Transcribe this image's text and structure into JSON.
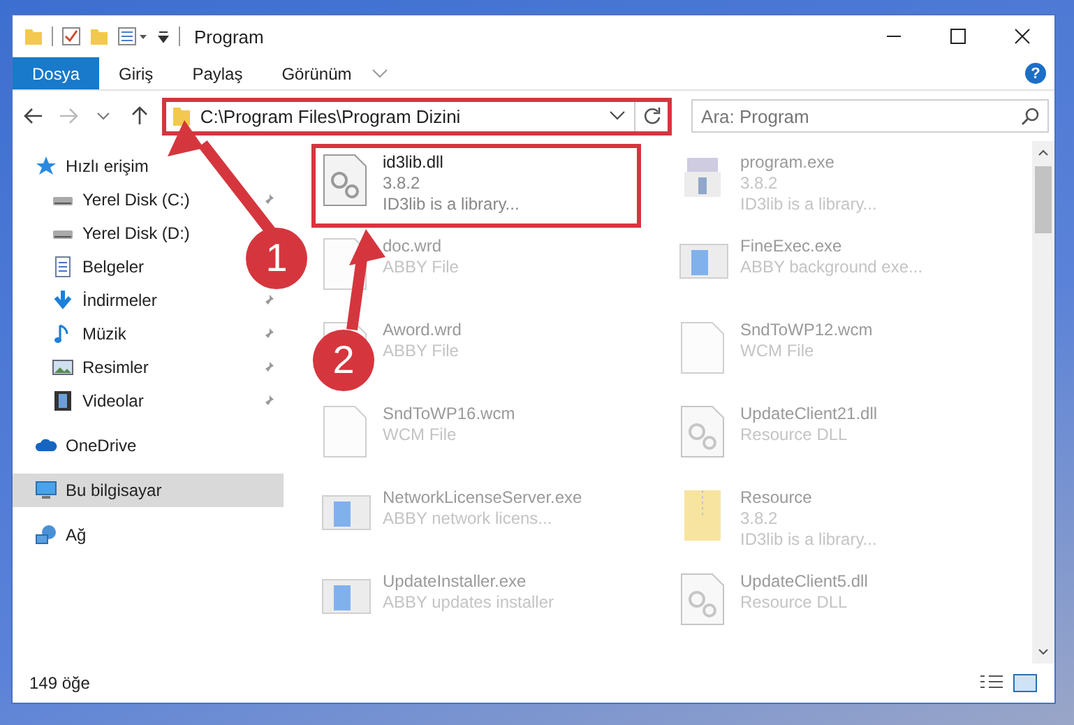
{
  "window": {
    "title": "Program"
  },
  "ribbon": {
    "tabs": [
      {
        "label": "Dosya",
        "selected": true
      },
      {
        "label": "Giriş",
        "selected": false
      },
      {
        "label": "Paylaş",
        "selected": false
      },
      {
        "label": "Görünüm",
        "selected": false
      }
    ],
    "help": "?"
  },
  "address_bar": {
    "path": "C:\\Program Files\\Program Dizini",
    "highlighted": true
  },
  "search": {
    "placeholder": "Ara: Program"
  },
  "sidebar": {
    "items": [
      {
        "label": "Hızlı erişim",
        "kind": "star",
        "pinned": false,
        "selected": false
      },
      {
        "label": "Yerel Disk (C:)",
        "kind": "disk",
        "pinned": true,
        "selected": false
      },
      {
        "label": "Yerel Disk (D:)",
        "kind": "disk",
        "pinned": false,
        "selected": false
      },
      {
        "label": "Belgeler",
        "kind": "docs",
        "pinned": false,
        "selected": false
      },
      {
        "label": "İndirmeler",
        "kind": "download",
        "pinned": true,
        "selected": false
      },
      {
        "label": "Müzik",
        "kind": "music",
        "pinned": true,
        "selected": false
      },
      {
        "label": "Resimler",
        "kind": "pictures",
        "pinned": true,
        "selected": false
      },
      {
        "label": "Videolar",
        "kind": "video",
        "pinned": true,
        "selected": false
      },
      {
        "label": "OneDrive",
        "kind": "cloud",
        "pinned": false,
        "selected": false
      },
      {
        "label": "Bu bilgisayar",
        "kind": "pc",
        "pinned": false,
        "selected": true
      },
      {
        "label": "Ağ",
        "kind": "network",
        "pinned": false,
        "selected": false
      }
    ]
  },
  "files": [
    {
      "kind": "dll",
      "name": "id3lib.dll",
      "lines": [
        "3.8.2",
        "ID3lib is a library..."
      ],
      "highlighted": true
    },
    {
      "kind": "setup",
      "name": "program.exe",
      "lines": [
        "3.8.2",
        "ID3lib is a library..."
      ],
      "highlighted": false
    },
    {
      "kind": "doc",
      "name": "doc.wrd",
      "lines": [
        "ABBY File"
      ],
      "highlighted": false
    },
    {
      "kind": "app",
      "name": "FineExec.exe",
      "lines": [
        "ABBY background exe..."
      ],
      "highlighted": false
    },
    {
      "kind": "doc",
      "name": "Aword.wrd",
      "lines": [
        "ABBY File"
      ],
      "highlighted": false
    },
    {
      "kind": "doc",
      "name": "SndToWP12.wcm",
      "lines": [
        "WCM File"
      ],
      "highlighted": false
    },
    {
      "kind": "doc",
      "name": "SndToWP16.wcm",
      "lines": [
        "WCM File"
      ],
      "highlighted": false
    },
    {
      "kind": "dll",
      "name": "UpdateClient21.dll",
      "lines": [
        "Resource DLL"
      ],
      "highlighted": false
    },
    {
      "kind": "app",
      "name": "NetworkLicenseServer.exe",
      "lines": [
        "ABBY network licens..."
      ],
      "highlighted": false
    },
    {
      "kind": "archive",
      "name": "Resource",
      "lines": [
        "3.8.2",
        "ID3lib is a library..."
      ],
      "highlighted": false
    },
    {
      "kind": "app",
      "name": "UpdateInstaller.exe",
      "lines": [
        "ABBY updates installer"
      ],
      "highlighted": false
    },
    {
      "kind": "dll",
      "name": "UpdateClient5.dll",
      "lines": [
        "Resource DLL"
      ],
      "highlighted": false
    }
  ],
  "status_bar": {
    "count": "149 öğe"
  },
  "callouts": [
    {
      "number": "1"
    },
    {
      "number": "2"
    }
  ]
}
